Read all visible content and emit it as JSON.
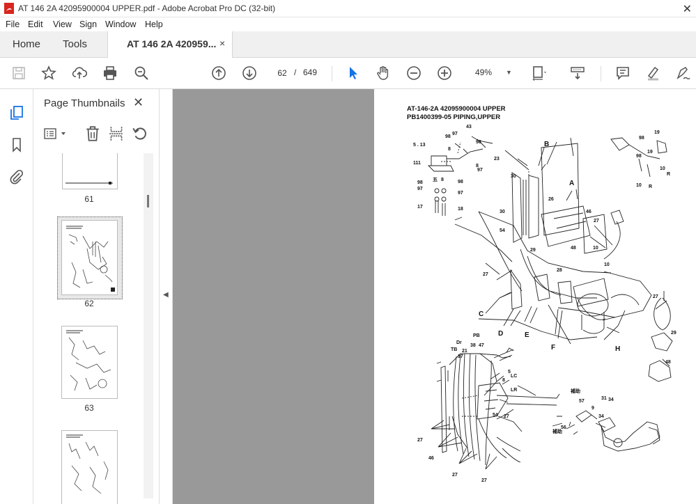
{
  "window": {
    "title": "AT 146 2A 42095900004 UPPER.pdf - Adobe Acrobat Pro DC (32-bit)"
  },
  "menu": [
    "File",
    "Edit",
    "View",
    "Sign",
    "Window",
    "Help"
  ],
  "tabs": {
    "home": "Home",
    "tools": "Tools",
    "document": "AT 146 2A 420959...",
    "close": "×"
  },
  "toolbar": {
    "current_page": "62",
    "page_separator": "/",
    "total_pages": "649",
    "zoom": "49%",
    "icons": [
      "save-icon",
      "star-icon",
      "upload-icon",
      "print-icon",
      "search-zoom-icon",
      "page-up-icon",
      "page-down-icon",
      "select-arrow-icon",
      "hand-icon",
      "zoom-out-icon",
      "zoom-in-icon",
      "page-fit-icon",
      "scroll-mode-icon",
      "comment-icon",
      "highlight-icon",
      "sign-icon"
    ]
  },
  "sidebar": {
    "title": "Page Thumbnails",
    "close": "✕",
    "thumbnails": [
      {
        "label": "61"
      },
      {
        "label": "62",
        "selected": true
      },
      {
        "label": "63"
      },
      {
        "label": ""
      }
    ]
  },
  "page": {
    "heading_line1": "AT-146-2A 42095900004 UPPER",
    "heading_line2": "PB1400399-05 PIPING,UPPER"
  },
  "colors": {
    "accent": "#1473e6",
    "doc_background": "#999999",
    "toolbar_icon": "#555555"
  }
}
